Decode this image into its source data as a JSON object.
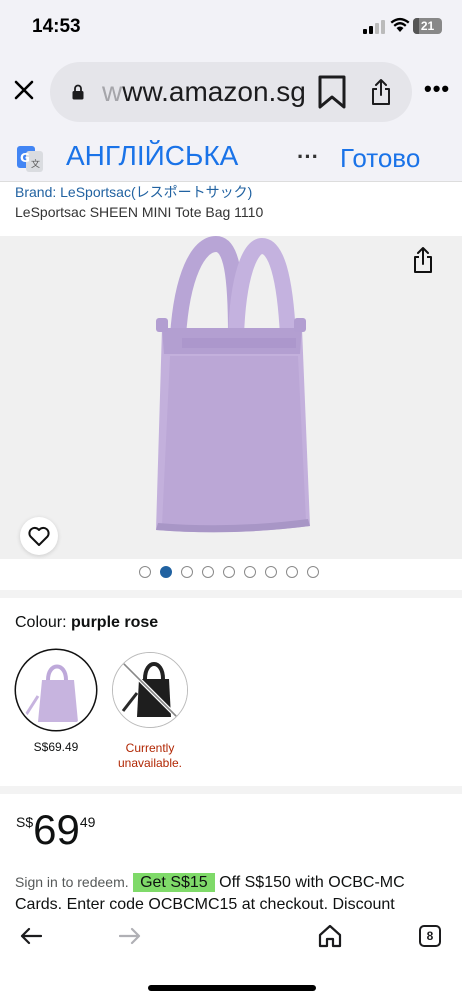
{
  "status_bar": {
    "time": "14:53",
    "battery": "21",
    "battery_level": 0.21
  },
  "browser": {
    "url_faded": "w",
    "url_main": "ww.amazon.sg"
  },
  "translate_bar": {
    "target_language": "АНГЛІЙСЬКА",
    "more": "···",
    "done": "Готово"
  },
  "product": {
    "brand_line": "Brand: LeSportsac(レスポートサック)",
    "title": "LeSportsac SHEEN MINI Tote Bag 1110",
    "image_index": 1,
    "image_count": 9,
    "colour_label": "Colour:",
    "colour_value": "purple rose",
    "variants": [
      {
        "price": "S$69.49"
      },
      {
        "status": "Currently unavailable."
      }
    ],
    "price": {
      "currency": "S$",
      "whole": "69",
      "fraction": "49"
    }
  },
  "promo": {
    "sign_in": "Sign in to redeem.",
    "coupon": "Get S$15",
    "text": "Off S$150 with OCBC-MC Cards. Enter code OCBCMC15 at checkout. Discount"
  },
  "bottom_nav": {
    "tab_count": "8"
  },
  "colors": {
    "accent_blue": "#1a73e8",
    "link_blue": "#2162a1",
    "coupon_green": "#7fda69",
    "bag_lavender": "#c3b0dc",
    "unavailable_red": "#b12704"
  }
}
